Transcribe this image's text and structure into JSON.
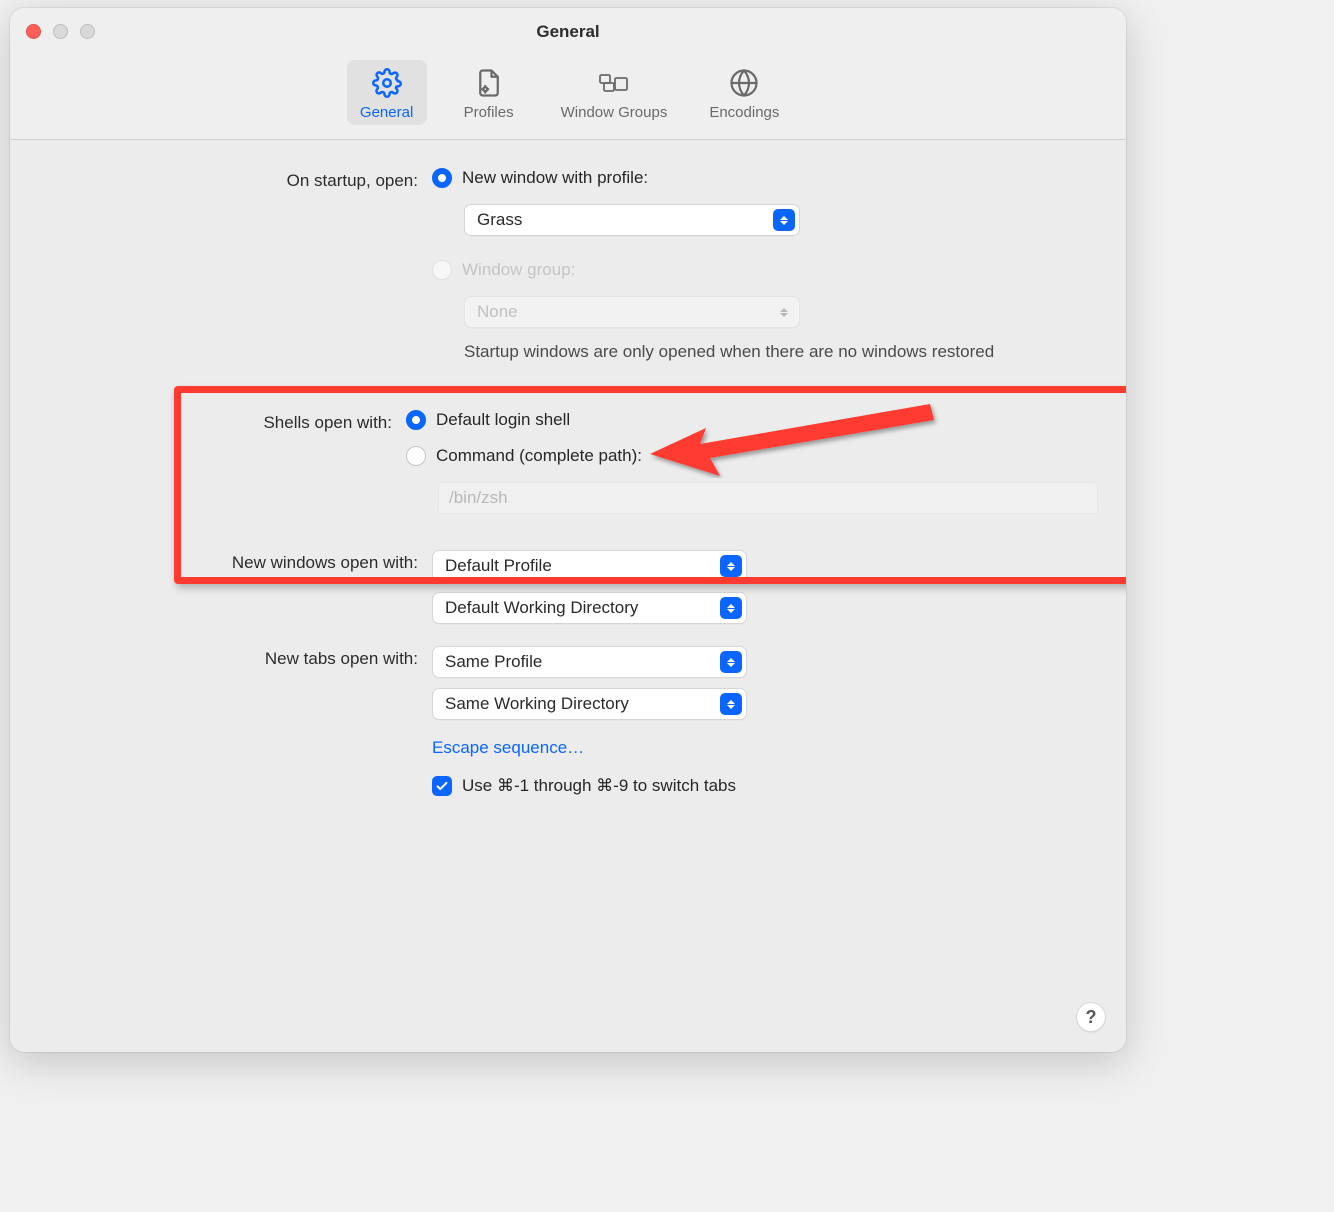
{
  "window": {
    "title": "General"
  },
  "toolbar": {
    "items": [
      {
        "label": "General"
      },
      {
        "label": "Profiles"
      },
      {
        "label": "Window Groups"
      },
      {
        "label": "Encodings"
      }
    ]
  },
  "startup": {
    "label": "On startup, open:",
    "opt_profile": "New window with profile:",
    "profile_value": "Grass",
    "opt_group": "Window group:",
    "group_value": "None",
    "note": "Startup windows are only opened when there are no windows restored"
  },
  "shells": {
    "label": "Shells open with:",
    "opt_default": "Default login shell",
    "opt_command": "Command (complete path):",
    "command_placeholder": "/bin/zsh"
  },
  "new_windows": {
    "label": "New windows open with:",
    "profile_value": "Default Profile",
    "dir_value": "Default Working Directory"
  },
  "new_tabs": {
    "label": "New tabs open with:",
    "profile_value": "Same Profile",
    "dir_value": "Same Working Directory"
  },
  "escape_link": "Escape sequence…",
  "cmd_switch_label": "Use ⌘-1 through ⌘-9 to switch tabs",
  "help": "?"
}
